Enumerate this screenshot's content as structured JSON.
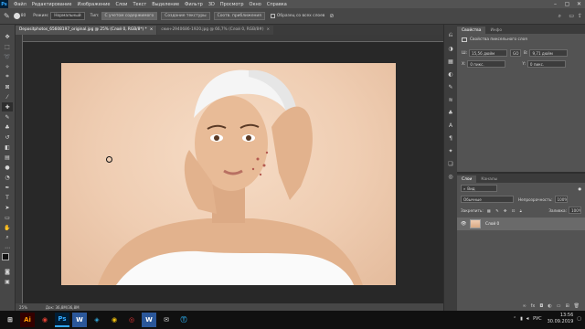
{
  "menubar": {
    "app_logo": "Ps",
    "items": [
      "Файл",
      "Редактирование",
      "Изображение",
      "Слои",
      "Текст",
      "Выделение",
      "Фильтр",
      "3D",
      "Просмотр",
      "Окно",
      "Справка"
    ]
  },
  "options": {
    "brush_size": "80",
    "mode_label": "Режим:",
    "mode_value": "Нормальный",
    "type_label": "Тип:",
    "type_content_aware": "С учетом содержимого",
    "type_texture": "Создание текстуры",
    "type_proximity": "Соотв. приближения",
    "sample_all_layers": "Образец со всех слоев"
  },
  "document_tabs": [
    {
      "label": "Depositphotos_65608197_original.jpg @ 25% (Слой 0, RGB/8*) *",
      "active": true
    },
    {
      "label": "скин-2940686-1920.jpg @ 66,7% (Слой 0, RGB/8#)",
      "active": false
    }
  ],
  "statusbar": {
    "zoom": "25%",
    "doc": "Док: 36,8M/36,8M"
  },
  "properties_panel": {
    "tabs": [
      "Свойства",
      "Инфо"
    ],
    "title": "Свойства пиксельного слоя",
    "w_label": "Ш:",
    "w_value": "15,56 дюйм",
    "link": "GO",
    "h_label": "В:",
    "h_value": "9,71 дюйм",
    "x_label": "X:",
    "x_value": "0 пикс.",
    "y_label": "Y:",
    "y_value": "0 пикс."
  },
  "layers_panel": {
    "tabs": [
      "Слои",
      "Каналы"
    ],
    "search_label": "Вид",
    "blend_mode": "Обычные",
    "opacity_label": "Непрозрачность:",
    "opacity_value": "100%",
    "lock_label": "Закрепить:",
    "fill_label": "Заливка:",
    "fill_value": "100%",
    "layer_name": "Слой 0"
  },
  "taskbar": {
    "apps": [
      "⊞",
      "Ai",
      "◉",
      "Ps",
      "W",
      "◈",
      "◉",
      "◎",
      "W",
      "✉",
      "Ⓣ"
    ],
    "lang": "РУС",
    "time": "13:56",
    "date": "30.09.2019"
  },
  "colors": {
    "accent": "#31a8ff",
    "panel": "#535353",
    "dark": "#282828"
  }
}
